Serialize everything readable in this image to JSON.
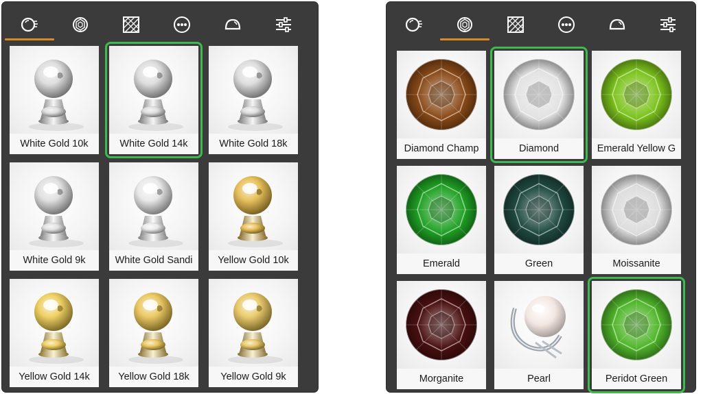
{
  "panels": [
    {
      "tabs": [
        {
          "icon": "metal-sphere-icon",
          "active": true
        },
        {
          "icon": "gem-icon",
          "active": false
        },
        {
          "icon": "texture-hatch-icon",
          "active": false
        },
        {
          "icon": "more-options-icon",
          "active": false
        },
        {
          "icon": "dome-icon",
          "active": false
        },
        {
          "icon": "sliders-icon",
          "active": false
        }
      ],
      "items": [
        {
          "label": "White Gold 10k",
          "kind": "metal",
          "color": "#d8d8d8",
          "selected": false
        },
        {
          "label": "White Gold 14k",
          "kind": "metal",
          "color": "#d8d8d8",
          "selected": true
        },
        {
          "label": "White Gold 18k",
          "kind": "metal",
          "color": "#d8d8d8",
          "selected": false
        },
        {
          "label": "White Gold 9k",
          "kind": "metal",
          "color": "#dcdcdc",
          "selected": false
        },
        {
          "label": "White Gold Sandi",
          "kind": "metal",
          "color": "#e6e6e6",
          "selected": false
        },
        {
          "label": "Yellow Gold 10k",
          "kind": "metal",
          "color": "#e3b640",
          "selected": false
        },
        {
          "label": "Yellow Gold 14k",
          "kind": "metal",
          "color": "#ecc84a",
          "selected": false
        },
        {
          "label": "Yellow Gold 18k",
          "kind": "metal",
          "color": "#e8c04a",
          "selected": false
        },
        {
          "label": "Yellow Gold 9k",
          "kind": "metal",
          "color": "#e6c254",
          "selected": false
        }
      ]
    },
    {
      "tabs": [
        {
          "icon": "metal-sphere-icon",
          "active": false
        },
        {
          "icon": "gem-icon",
          "active": true
        },
        {
          "icon": "texture-hatch-icon",
          "active": false
        },
        {
          "icon": "more-options-icon",
          "active": false
        },
        {
          "icon": "dome-icon",
          "active": false
        },
        {
          "icon": "sliders-icon",
          "active": false
        }
      ],
      "items": [
        {
          "label": "Diamond Champ",
          "kind": "gem",
          "color": "#8a4a18",
          "selected": false
        },
        {
          "label": "Diamond",
          "kind": "gem",
          "color": "#e2e2e2",
          "selected": true
        },
        {
          "label": "Emerald Yellow G",
          "kind": "gem",
          "color": "#7cc21c",
          "selected": false
        },
        {
          "label": "Emerald",
          "kind": "gem",
          "color": "#1fa024",
          "selected": false
        },
        {
          "label": "Green",
          "kind": "gem",
          "color": "#1f4a40",
          "selected": false
        },
        {
          "label": "Moissanite",
          "kind": "gem",
          "color": "#dcdcdc",
          "selected": false
        },
        {
          "label": "Morganite",
          "kind": "gem",
          "color": "#4a1010",
          "selected": false
        },
        {
          "label": "Pearl",
          "kind": "pearl",
          "color": "#f3e6e1",
          "selected": false
        },
        {
          "label": "Peridot Green",
          "kind": "gem",
          "color": "#4fb52a",
          "selected": true
        }
      ]
    }
  ],
  "accent": "#d98b26",
  "selection_color": "#3fba4f"
}
